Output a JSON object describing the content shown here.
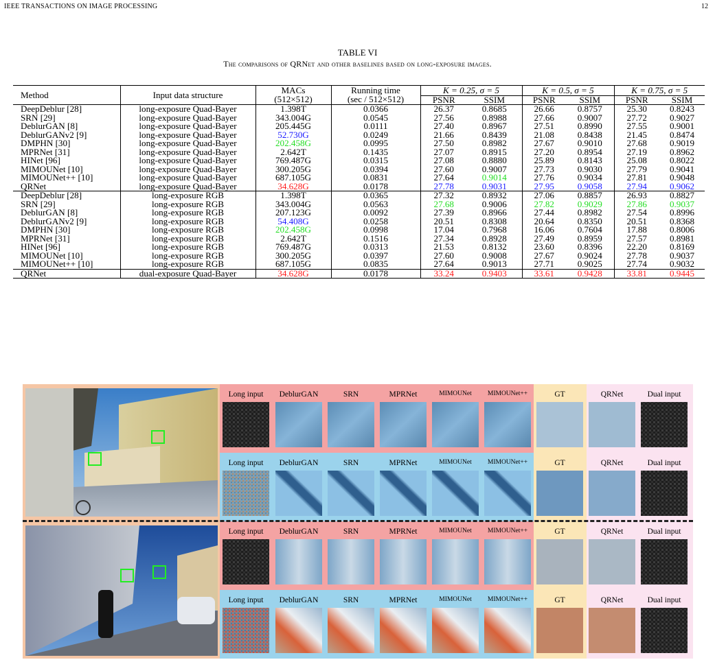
{
  "header": {
    "journal": "IEEE TRANSACTIONS ON IMAGE PROCESSING",
    "page": "12"
  },
  "table": {
    "title": "TABLE VI",
    "caption": "The comparisons of QRNet and other baselines based on long-exposure images.",
    "col_method": "Method",
    "col_input": "Input data structure",
    "col_macs": "MACs",
    "col_macs_sub": "(512×512)",
    "col_time": "Running time",
    "col_time_sub": "(sec / 512×512)",
    "k1": "K = 0.25, σ = 5",
    "k2": "K = 0.5, σ = 5",
    "k3": "K = 0.75, σ = 5",
    "psnr": "PSNR",
    "ssim": "SSIM",
    "colors": {
      "red": "#ff1a1a",
      "blue": "#1a1aff",
      "green": "#22dd22"
    },
    "rows": [
      {
        "method": "DeepDeblur [28]",
        "input": "long-exposure Quad-Bayer",
        "macs": "1.398T",
        "time": "0.0366",
        "v": [
          "26.37",
          "0.8685",
          "26.66",
          "0.8757",
          "25.30",
          "0.8243"
        ]
      },
      {
        "method": "SRN [29]",
        "input": "long-exposure Quad-Bayer",
        "macs": "343.004G",
        "time": "0.0545",
        "v": [
          "27.56",
          "0.8988",
          "27.66",
          "0.9007",
          "27.72",
          "0.9027"
        ]
      },
      {
        "method": "DeblurGAN [8]",
        "input": "long-exposure Quad-Bayer",
        "macs": "205.445G",
        "time": "0.0111",
        "v": [
          "27.40",
          "0.8967",
          "27.51",
          "0.8990",
          "27.55",
          "0.9001"
        ]
      },
      {
        "method": "DeblurGANv2 [9]",
        "input": "long-exposure Quad-Bayer",
        "macs": "52.730G",
        "macs_c": "blue",
        "time": "0.0249",
        "v": [
          "21.66",
          "0.8439",
          "21.08",
          "0.8438",
          "21.45",
          "0.8474"
        ]
      },
      {
        "method": "DMPHN [30]",
        "input": "long-exposure Quad-Bayer",
        "macs": "202.458G",
        "macs_c": "green",
        "time": "0.0995",
        "v": [
          "27.50",
          "0.8982",
          "27.67",
          "0.9010",
          "27.68",
          "0.9019"
        ]
      },
      {
        "method": "MPRNet [31]",
        "input": "long-exposure Quad-Bayer",
        "macs": "2.642T",
        "time": "0.1435",
        "v": [
          "27.07",
          "0.8915",
          "27.20",
          "0.8954",
          "27.19",
          "0.8962"
        ]
      },
      {
        "method": "HINet [96]",
        "input": "long-exposure Quad-Bayer",
        "macs": "769.487G",
        "time": "0.0315",
        "v": [
          "27.08",
          "0.8880",
          "25.89",
          "0.8143",
          "25.08",
          "0.8022"
        ]
      },
      {
        "method": "MIMOUNet [10]",
        "input": "long-exposure Quad-Bayer",
        "macs": "300.205G",
        "time": "0.0394",
        "v": [
          "27.60",
          "0.9007",
          "27.73",
          "0.9030",
          "27.79",
          "0.9041"
        ]
      },
      {
        "method": "MIMOUNet++ [10]",
        "input": "long-exposure Quad-Bayer",
        "macs": "687.105G",
        "time": "0.0831",
        "v": [
          "27.64",
          "0.9014",
          "27.76",
          "0.9034",
          "27.81",
          "0.9048"
        ],
        "vc": [
          "",
          "green",
          "",
          "",
          "",
          ""
        ]
      },
      {
        "method": "QRNet",
        "input": "long-exposure Quad-Bayer",
        "macs": "34.628G",
        "macs_c": "red",
        "time": "0.0178",
        "v": [
          "27.78",
          "0.9031",
          "27.95",
          "0.9058",
          "27.94",
          "0.9062"
        ],
        "vc": [
          "blue",
          "blue",
          "blue",
          "blue",
          "blue",
          "blue"
        ]
      },
      {
        "method": "DeepDeblur [28]",
        "input": "long-exposure RGB",
        "macs": "1.398T",
        "time": "0.0365",
        "v": [
          "27.32",
          "0.8932",
          "27.06",
          "0.8857",
          "26.93",
          "0.8827"
        ]
      },
      {
        "method": "SRN [29]",
        "input": "long-exposure RGB",
        "macs": "343.004G",
        "time": "0.0563",
        "v": [
          "27.68",
          "0.9006",
          "27.82",
          "0.9029",
          "27.86",
          "0.9037"
        ],
        "vc": [
          "green",
          "",
          "green",
          "green",
          "green",
          "green"
        ]
      },
      {
        "method": "DeblurGAN [8]",
        "input": "long-exposure RGB",
        "macs": "207.123G",
        "time": "0.0092",
        "v": [
          "27.39",
          "0.8966",
          "27.44",
          "0.8982",
          "27.54",
          "0.8996"
        ]
      },
      {
        "method": "DeblurGANv2 [9]",
        "input": "long-exposure RGB",
        "macs": "54.408G",
        "macs_c": "blue",
        "time": "0.0258",
        "v": [
          "20.51",
          "0.8308",
          "20.64",
          "0.8350",
          "20.51",
          "0.8368"
        ]
      },
      {
        "method": "DMPHN [30]",
        "input": "long-exposure RGB",
        "macs": "202.458G",
        "macs_c": "green",
        "time": "0.0998",
        "v": [
          "17.04",
          "0.7968",
          "16.06",
          "0.7604",
          "17.88",
          "0.8006"
        ]
      },
      {
        "method": "MPRNet [31]",
        "input": "long-exposure RGB",
        "macs": "2.642T",
        "time": "0.1516",
        "v": [
          "27.34",
          "0.8928",
          "27.49",
          "0.8959",
          "27.57",
          "0.8981"
        ]
      },
      {
        "method": "HINet [96]",
        "input": "long-exposure RGB",
        "macs": "769.487G",
        "time": "0.0313",
        "v": [
          "21.53",
          "0.8132",
          "23.60",
          "0.8396",
          "22.20",
          "0.8169"
        ]
      },
      {
        "method": "MIMOUNet [10]",
        "input": "long-exposure RGB",
        "macs": "300.205G",
        "time": "0.0397",
        "v": [
          "27.60",
          "0.9008",
          "27.67",
          "0.9024",
          "27.78",
          "0.9037"
        ]
      },
      {
        "method": "MIMOUNet++ [10]",
        "input": "long-exposure RGB",
        "macs": "687.105G",
        "time": "0.0835",
        "v": [
          "27.64",
          "0.9013",
          "27.71",
          "0.9025",
          "27.74",
          "0.9032"
        ]
      },
      {
        "method": "QRNet",
        "input": "dual-exposure Quad-Bayer",
        "macs": "34.628G",
        "macs_c": "red",
        "time": "0.0178",
        "v": [
          "33.24",
          "0.9403",
          "33.61",
          "0.9428",
          "33.81",
          "0.9445"
        ],
        "vc": [
          "red",
          "red",
          "red",
          "red",
          "red",
          "red"
        ]
      }
    ]
  },
  "figure": {
    "labels": [
      "Long input",
      "DeblurGAN",
      "SRN",
      "MPRNet",
      "MIMOUNet",
      "MIMOUNet++",
      "GT",
      "QRNet",
      "Dual input"
    ],
    "colors": {
      "frame": "#f5c6a5",
      "pink": "#f4a3a3",
      "blue": "#9bd3ec",
      "gt": "#fbe6b7",
      "qr": "#fbe3f0",
      "box": "#22ee22"
    }
  }
}
